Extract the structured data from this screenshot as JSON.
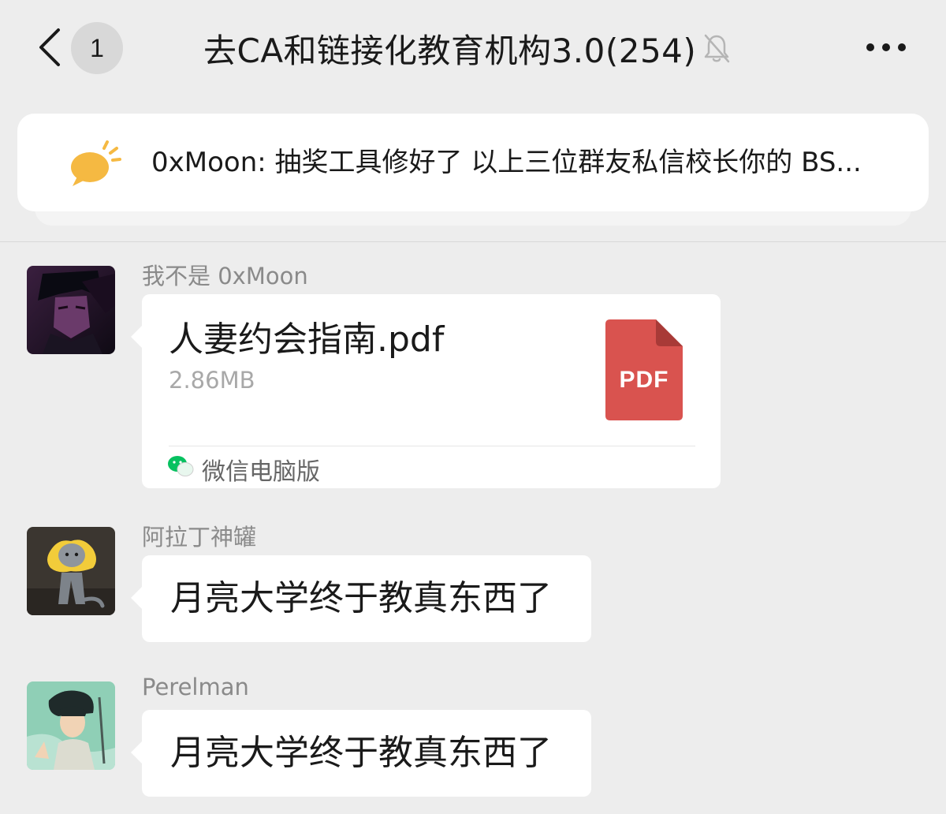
{
  "header": {
    "back_icon": "chevron-left-icon",
    "unread_count": "1",
    "title": "去CA和链接化教育机构3.0(254)",
    "mute_icon": "bell-muted-icon",
    "more_icon": "ellipsis-icon"
  },
  "pinned": {
    "icon": "speech-bubble-icon",
    "text": "0xMoon: 抽奖工具修好了 以上三位群友私信校长你的 BS..."
  },
  "messages": [
    {
      "sender": "我不是 0xMoon",
      "type": "file",
      "file_name": "人妻约会指南.pdf",
      "file_size": "2.86MB",
      "file_icon_label": "PDF",
      "source_label": "微信电脑版"
    },
    {
      "sender": "阿拉丁神罐",
      "type": "text",
      "text": "月亮大学终于教真东西了"
    },
    {
      "sender": "Perelman",
      "type": "text",
      "text": "月亮大学终于教真东西了"
    }
  ],
  "colors": {
    "background": "#ededed",
    "bubble": "#ffffff",
    "pdf_red": "#d9534f",
    "pinned_icon": "#f5b942",
    "wechat_green": "#07c160"
  }
}
